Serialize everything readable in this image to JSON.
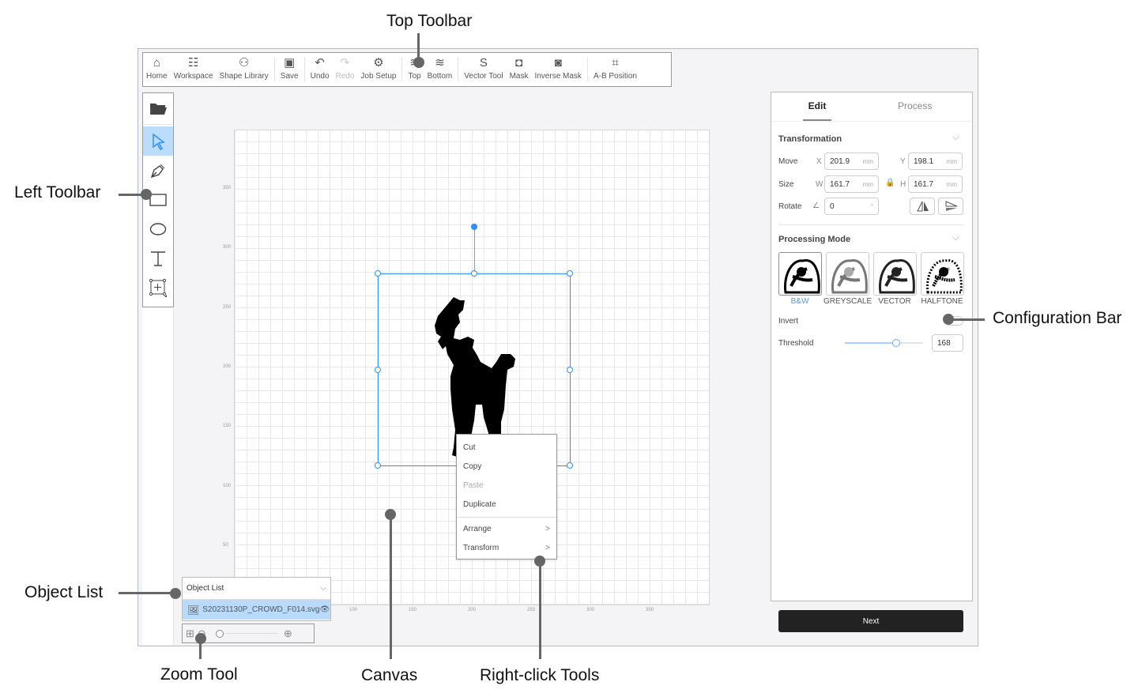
{
  "callouts": {
    "top_toolbar": "Top Toolbar",
    "left_toolbar": "Left Toolbar",
    "object_list": "Object List",
    "zoom_tool": "Zoom Tool",
    "canvas": "Canvas",
    "right_click": "Right-click Tools",
    "config_bar": "Configuration Bar"
  },
  "toolbar": [
    {
      "label": "Home",
      "icon": "⌂",
      "disabled": false
    },
    {
      "label": "Workspace",
      "icon": "☷",
      "disabled": false
    },
    {
      "label": "Shape Library",
      "icon": "⚇",
      "disabled": false
    },
    {
      "label": "Save",
      "icon": "▣",
      "disabled": false
    },
    {
      "label": "Undo",
      "icon": "↶",
      "disabled": false
    },
    {
      "label": "Redo",
      "icon": "↷",
      "disabled": true
    },
    {
      "label": "Job Setup",
      "icon": "⚙",
      "disabled": false
    },
    {
      "label": "Top",
      "icon": "≋",
      "disabled": false
    },
    {
      "label": "Bottom",
      "icon": "≋",
      "disabled": false
    },
    {
      "label": "Vector Tool",
      "icon": "S",
      "disabled": false
    },
    {
      "label": "Mask",
      "icon": "◘",
      "disabled": false
    },
    {
      "label": "Inverse Mask",
      "icon": "◙",
      "disabled": false
    },
    {
      "label": "A-B Position",
      "icon": "⌗",
      "disabled": false
    }
  ],
  "left_tools": [
    "open-folder",
    "select",
    "pen",
    "rectangle",
    "ellipse",
    "text",
    "frame"
  ],
  "canvas": {
    "x_ticks": [
      "100",
      "150",
      "200",
      "250",
      "300",
      "350"
    ],
    "y_ticks": [
      "350",
      "300",
      "250",
      "200",
      "150",
      "100",
      "50"
    ]
  },
  "context_menu": {
    "items": [
      "Cut",
      "Copy",
      "Paste",
      "Duplicate"
    ],
    "sub": [
      "Arrange",
      "Transform"
    ],
    "disabled": "Paste",
    "arrow": ">"
  },
  "object_list": {
    "title": "Object List",
    "file": "S20231130P_CROWD_F014.svg"
  },
  "zoom": {
    "level": 0
  },
  "panel": {
    "tabs": [
      "Edit",
      "Process"
    ],
    "active_tab": "Edit",
    "transformation": {
      "title": "Transformation",
      "move": "Move",
      "size": "Size",
      "rotate": "Rotate",
      "x": "201.9",
      "y": "198.1",
      "w": "161.7",
      "h": "161.7",
      "angle": "0",
      "unit": "mm",
      "deg": "°",
      "xl": "X",
      "yl": "Y",
      "wl": "W",
      "hl": "H"
    },
    "processing": {
      "title": "Processing Mode",
      "modes": [
        "B&W",
        "GREYSCALE",
        "VECTOR",
        "HALFTONE"
      ],
      "selected": "B&W",
      "invert": "Invert",
      "invert_on": false,
      "threshold_label": "Threshold",
      "threshold": "168",
      "threshold_fraction": 0.66
    },
    "next": "Next"
  },
  "colors": {
    "accent": "#2f8ef5",
    "selected_bg": "#bcdcfb",
    "next_bg": "#222222"
  }
}
